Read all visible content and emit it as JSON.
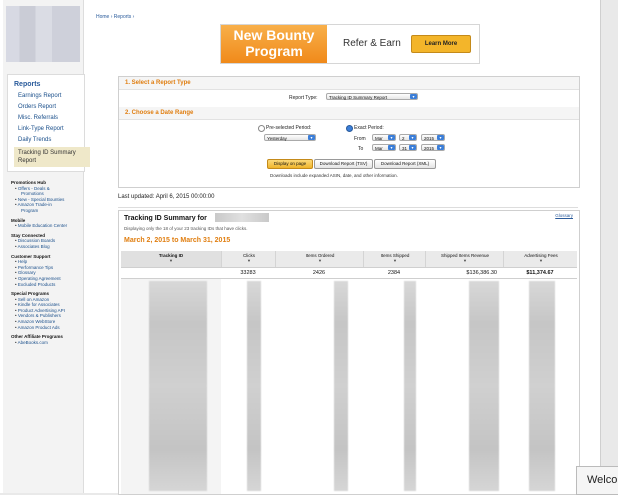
{
  "breadcrumb": "Home › Reports ›",
  "banner": {
    "line1": "New Bounty",
    "line2": "Program",
    "tagline": "Refer & Earn",
    "cta": "Learn More"
  },
  "left_nav": {
    "title": "Reports",
    "items": [
      "Earnings Report",
      "Orders Report",
      "Misc. Referrals",
      "Link-Type Report",
      "Daily Trends"
    ],
    "selected_line1": "Tracking ID Summary",
    "selected_line2": "Report"
  },
  "sidebar": {
    "promotions_hub": "Promotions Hub",
    "promo_items": [
      "Offers - Deals &",
      "Promotions",
      "New - Special Bounties",
      "Amazon Trade-in",
      "Program"
    ],
    "mobile": "Mobile",
    "mobile_items": [
      "Mobile Education Center"
    ],
    "stay_connected": "Stay Connected",
    "stay_items": [
      "Discussion Boards",
      "Associates Blog"
    ],
    "customer_support": "Customer Support",
    "support_items": [
      "Help",
      "Performance Tips",
      "Glossary",
      "Operating Agreement",
      "Excluded Products"
    ],
    "special_programs": "Special Programs",
    "special_items": [
      "Sell on Amazon",
      "Kindle for Associates",
      "Product Advertising API",
      "Vendors & Publishers",
      "Amazon WebStore",
      "Amazon Product Ads"
    ],
    "other_programs": "Other Affiliate Programs",
    "other_items": [
      "AbeBooks.com"
    ]
  },
  "form": {
    "section1": "1. Select a Report Type",
    "report_type_label": "Report Type:",
    "report_type_value": "Tracking ID Summary Report",
    "section2": "2. Choose a Date Range",
    "preselected_label": "Pre-selected Period:",
    "preselected_value": "Yesterday",
    "exact_label": "Exact Period:",
    "from_label": "From",
    "to_label": "To",
    "from_month": "Mar",
    "from_day": "2",
    "from_year": "2015",
    "to_month": "Mar",
    "to_day": "31",
    "to_year": "2015",
    "btn_display": "Display on page",
    "btn_tsv": "Download Report (TSV)",
    "btn_xml": "Download Report (XML)",
    "note": "Downloads include expanded ASIN, date, and other information."
  },
  "last_updated": "Last updated: April 6, 2015 00:00:00",
  "summary": {
    "title": "Tracking ID Summary for",
    "glossary": "Glossary",
    "subtitle": "Displaying only the 18 of your 23 tracking IDs that have clicks.",
    "range": "March 2, 2015 to March 31, 2015",
    "columns": [
      "Tracking ID",
      "Clicks",
      "Items Ordered",
      "Items Shipped",
      "Shipped Items Revenue",
      "Advertising Fees"
    ],
    "sort_indicator": "▼",
    "totals": [
      "",
      "33283",
      "2426",
      "2384",
      "$136,386.30",
      "$11,374.67"
    ]
  },
  "welcome": "Welco"
}
